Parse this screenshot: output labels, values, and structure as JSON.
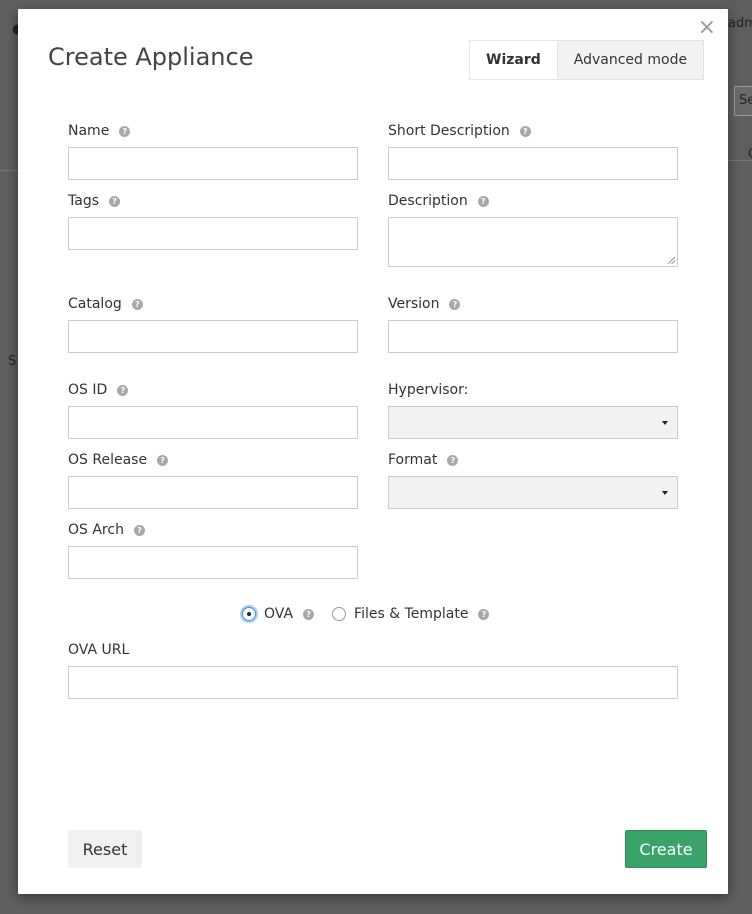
{
  "background": {
    "fragment_top_right": "adm",
    "fragment_search": "Se",
    "fragment_col": "C",
    "fragment_left": "S"
  },
  "modal": {
    "title": "Create Appliance",
    "close_glyph": "×",
    "tabs": [
      {
        "label": "Wizard",
        "active": true
      },
      {
        "label": "Advanced mode",
        "active": false
      }
    ]
  },
  "form": {
    "name": {
      "label": "Name",
      "value": ""
    },
    "short_description": {
      "label": "Short Description",
      "value": ""
    },
    "tags": {
      "label": "Tags",
      "value": ""
    },
    "description": {
      "label": "Description",
      "value": ""
    },
    "catalog": {
      "label": "Catalog",
      "value": ""
    },
    "version": {
      "label": "Version",
      "value": ""
    },
    "os_id": {
      "label": "OS ID",
      "value": ""
    },
    "hypervisor": {
      "label": "Hypervisor:",
      "value": ""
    },
    "os_release": {
      "label": "OS Release",
      "value": ""
    },
    "format": {
      "label": "Format",
      "value": ""
    },
    "os_arch": {
      "label": "OS Arch",
      "value": ""
    },
    "source_type": {
      "options": [
        {
          "label": "OVA",
          "checked": true
        },
        {
          "label": "Files & Template",
          "checked": false
        }
      ]
    },
    "ova_url": {
      "label": "OVA URL",
      "value": ""
    }
  },
  "actions": {
    "reset_label": "Reset",
    "create_label": "Create"
  },
  "colors": {
    "create_button": "#3aa36a",
    "overlay": "#5f5f5f",
    "radio_focus": "#4a90e2"
  },
  "icons": {
    "help": "question-circle-icon",
    "close": "close-icon",
    "dropdown": "caret-down-icon"
  }
}
